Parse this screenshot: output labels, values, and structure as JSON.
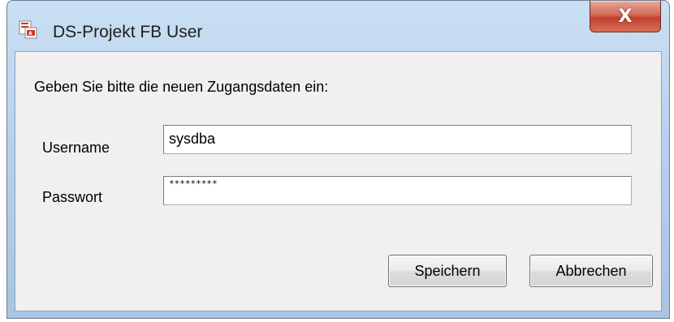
{
  "window": {
    "title": "DS-Projekt FB User",
    "close_label": "X"
  },
  "form": {
    "prompt": "Geben Sie bitte die neuen Zugangsdaten ein:",
    "username_label": "Username",
    "username_value": "sysdba",
    "password_label": "Passwort",
    "password_value": "*********"
  },
  "buttons": {
    "save_label": "Speichern",
    "cancel_label": "Abbrechen"
  },
  "colors": {
    "titlebar": "#b7d1ec",
    "close": "#c2412d",
    "client": "#f0f0f0"
  },
  "icons": {
    "app": "pdf-document-icon",
    "close": "close-icon"
  }
}
